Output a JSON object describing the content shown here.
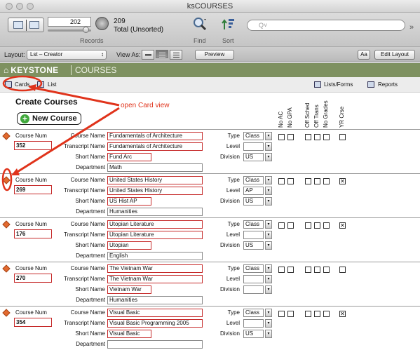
{
  "window": {
    "title": "ksCOURSES"
  },
  "toolbar": {
    "record_number": "202",
    "found_count": "209",
    "found_label": "Total (Unsorted)",
    "records_label": "Records",
    "find_label": "Find",
    "sort_label": "Sort",
    "search_placeholder": "Q˅"
  },
  "layoutbar": {
    "layout_label": "Layout:",
    "layout_value": "Lst – Creator",
    "view_as_label": "View As:",
    "preview_label": "Preview",
    "aa_label": "Aa",
    "edit_layout_label": "Edit Layout"
  },
  "banner": {
    "logo": "KEYSTONE",
    "section": "COURSES"
  },
  "tabs": {
    "cards": "Cards",
    "list": "List",
    "lists_forms": "Lists/Forms",
    "reports": "Reports"
  },
  "header": {
    "title": "Create Courses",
    "new_button": "New Course",
    "columns": [
      "No AC",
      "No GPA",
      "Off Sched",
      "Off Trans",
      "No Grades",
      "YR Crse"
    ]
  },
  "labels": {
    "course_num": "Course Num",
    "course_name": "Course Name",
    "transcript_name": "Transcript Name",
    "short_name": "Short Name",
    "department": "Department",
    "type": "Type",
    "level": "Level",
    "division": "Division"
  },
  "annotation": {
    "text": "open Card view",
    "color": "#e0331b"
  },
  "records": [
    {
      "num": "352",
      "course_name": "Fundamentals of Architecture",
      "transcript_name": "Fundamentals of Architecture",
      "short_name": "Fund Arc",
      "department": "Math",
      "type": "Class",
      "level": "",
      "division": "US",
      "yr_crse": false
    },
    {
      "num": "269",
      "course_name": "United States History",
      "transcript_name": "United States History",
      "short_name": "US Hist AP",
      "department": "Humanities",
      "type": "Class",
      "level": "AP",
      "division": "US",
      "yr_crse": true
    },
    {
      "num": "176",
      "course_name": "Utopian Literature",
      "transcript_name": "Utopian Literature",
      "short_name": "Utopian",
      "department": "English",
      "type": "Class",
      "level": "",
      "division": "US",
      "yr_crse": true
    },
    {
      "num": "270",
      "course_name": "The Vietnam War",
      "transcript_name": "The Vietnam War",
      "short_name": "Vietnam War",
      "department": "Humanities",
      "type": "Class",
      "level": "",
      "division": "",
      "yr_crse": false
    },
    {
      "num": "354",
      "course_name": "Visual Basic",
      "transcript_name": "Visual Basic Programming 2005",
      "short_name": "Visual Basic",
      "department": "",
      "type": "Class",
      "level": "",
      "division": "US",
      "yr_crse": true
    }
  ]
}
